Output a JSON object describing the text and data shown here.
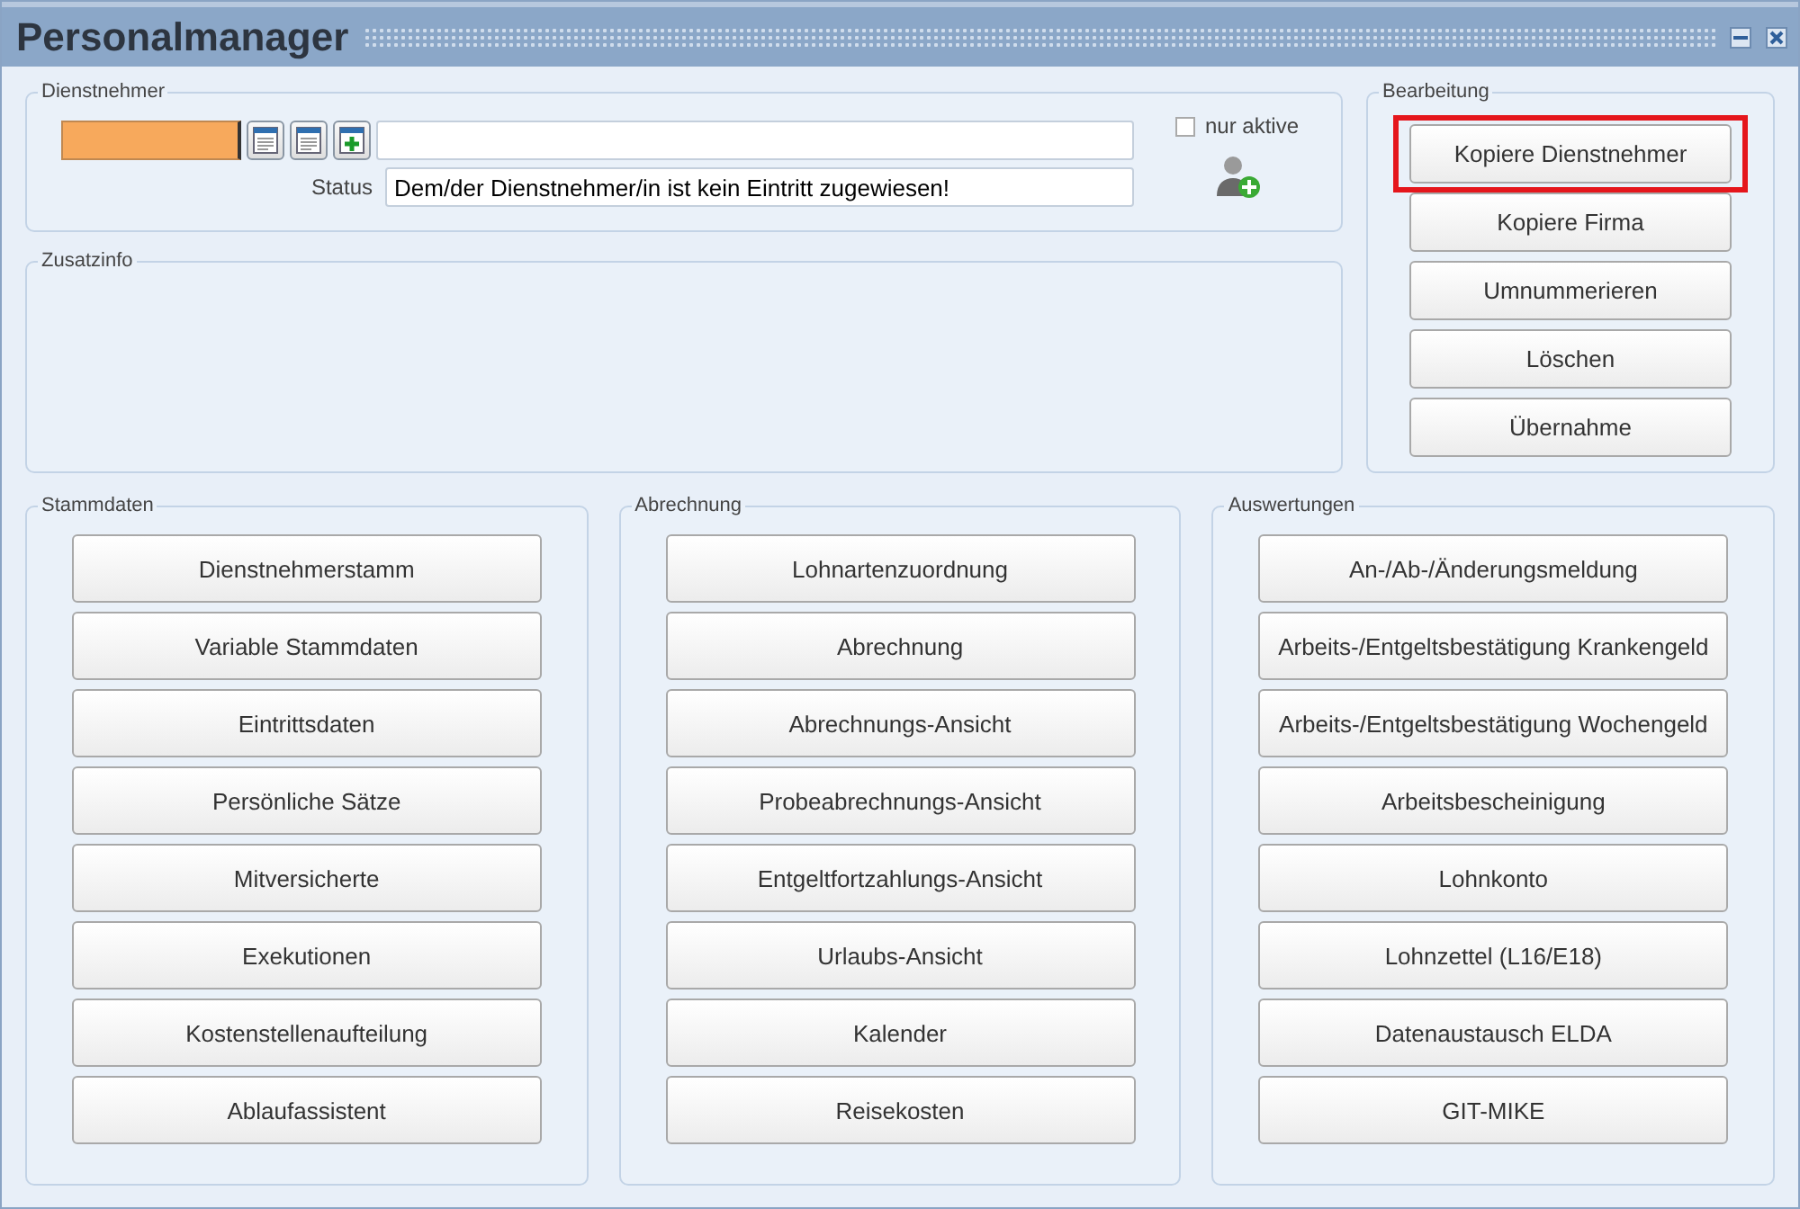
{
  "window": {
    "title": "Personalmanager"
  },
  "dienstnehmer": {
    "legend": "Dienstnehmer",
    "status_label": "Status",
    "status_value": "Dem/der Dienstnehmer/in ist kein Eintritt zugewiesen!",
    "nur_aktive": {
      "label": "nur aktive",
      "checked": false
    }
  },
  "zusatzinfo": {
    "legend": "Zusatzinfo"
  },
  "bearbeitung": {
    "legend": "Bearbeitung",
    "buttons": [
      {
        "label": "Kopiere Dienstnehmer",
        "highlighted": true
      },
      {
        "label": "Kopiere Firma",
        "highlighted": false
      },
      {
        "label": "Umnummerieren",
        "highlighted": false
      },
      {
        "label": "Löschen",
        "highlighted": false
      },
      {
        "label": "Übernahme",
        "highlighted": false
      }
    ]
  },
  "groups": [
    {
      "legend": "Stammdaten",
      "buttons": [
        "Dienstnehmerstamm",
        "Variable Stammdaten",
        "Eintrittsdaten",
        "Persönliche Sätze",
        "Mitversicherte",
        "Exekutionen",
        "Kostenstellenaufteilung",
        "Ablaufassistent"
      ]
    },
    {
      "legend": "Abrechnung",
      "buttons": [
        "Lohnartenzuordnung",
        "Abrechnung",
        "Abrechnungs-Ansicht",
        "Probeabrechnungs-Ansicht",
        "Entgeltfortzahlungs-Ansicht",
        "Urlaubs-Ansicht",
        "Kalender",
        "Reisekosten"
      ]
    },
    {
      "legend": "Auswertungen",
      "buttons": [
        "An-/Ab-/Änderungsmeldung",
        "Arbeits-/Entgeltsbestätigung Krankengeld",
        "Arbeits-/Entgeltsbestätigung Wochengeld",
        "Arbeitsbescheinigung",
        "Lohnkonto",
        "Lohnzettel (L16/E18)",
        "Datenaustausch ELDA",
        "GIT-MIKE"
      ]
    }
  ]
}
